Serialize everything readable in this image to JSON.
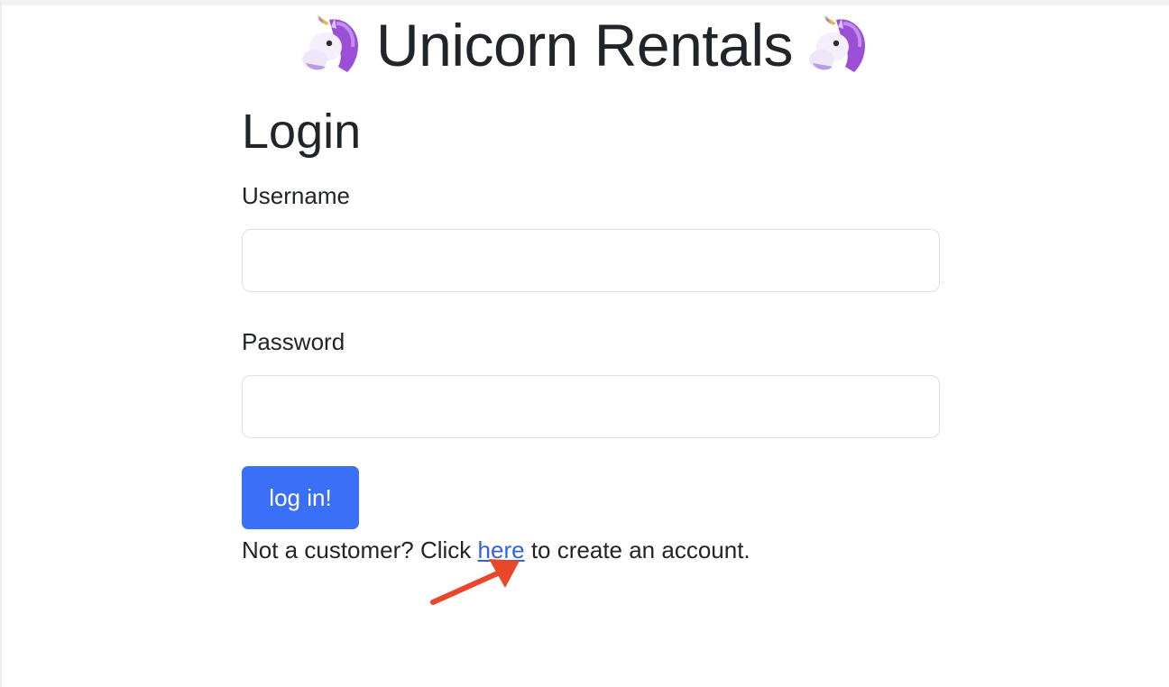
{
  "header": {
    "title": "Unicorn Rentals",
    "emoji_icon": "unicorn-icon"
  },
  "login_form": {
    "heading": "Login",
    "username_label": "Username",
    "username_value": "",
    "password_label": "Password",
    "password_value": "",
    "submit_label": "log in!"
  },
  "signup_prompt": {
    "before_link": "Not a customer? Click",
    "link_text": "here",
    "after_link": "to create an account."
  },
  "annotation": {
    "arrow_icon": "red-arrow-icon",
    "arrow_color": "#e8472c"
  },
  "colors": {
    "primary_button": "#3a6ff7",
    "link": "#2f62e8",
    "text": "#212529"
  }
}
